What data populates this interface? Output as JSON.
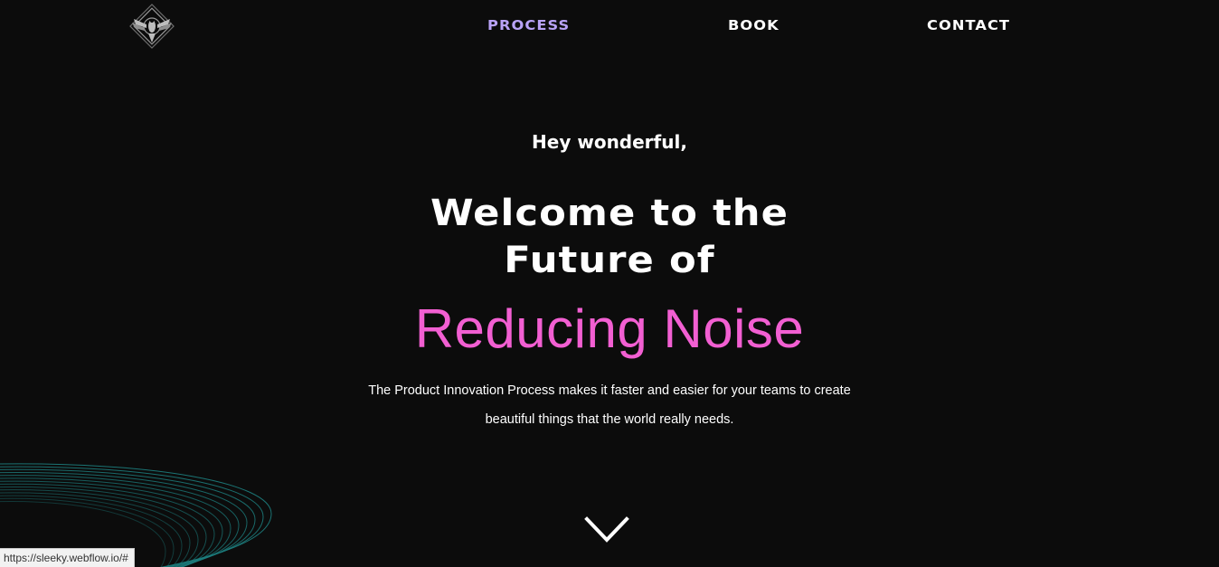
{
  "nav": {
    "process_label": "PROCESS",
    "book_label": "BOOK",
    "contact_label": "CONTACT"
  },
  "hero": {
    "greeting": "Hey wonderful,",
    "headline_line1": "Welcome to the",
    "headline_line2": "Future of",
    "accent_text": "Reducing Noise",
    "description": "The Product Innovation Process makes it faster and easier for your teams to create beautiful things that the world really needs."
  },
  "status_bar": {
    "url": "https://sleeky.webflow.io/#"
  },
  "icons": {
    "logo": "ornate-eagle-emblem-icon",
    "scroll_arrow": "chevron-down-icon",
    "waves": "concentric-wave-lines-decoration"
  },
  "colors": {
    "background": "#0c0c0c",
    "text": "#ffffff",
    "nav_active": "#b9a3f7",
    "accent_pink": "#f25fd2",
    "wave_teal": "#1d7f7f",
    "status_bar_bg": "#f2f2f2"
  }
}
